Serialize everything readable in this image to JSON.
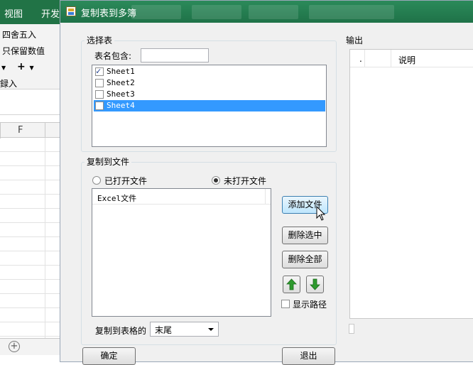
{
  "excel": {
    "tabs": [
      "视图",
      "开发"
    ],
    "ribbon": {
      "round_label": "四舍五入",
      "keep_values_label": "只保留数值",
      "add_label": "+",
      "entry_label": "録入"
    },
    "column_header": "F",
    "add_sheet": "+"
  },
  "dialog": {
    "title": "复制表到多簿",
    "select_sheet": {
      "legend": "选择表",
      "name_contains_label": "表名包含:",
      "name_contains_value": "",
      "sheets": [
        {
          "name": "Sheet1",
          "checked": true,
          "selected": false
        },
        {
          "name": "Sheet2",
          "checked": false,
          "selected": false
        },
        {
          "name": "Sheet3",
          "checked": false,
          "selected": false
        },
        {
          "name": "Sheet4",
          "checked": false,
          "selected": true
        }
      ]
    },
    "copy_to_file": {
      "legend": "复制到文件",
      "radio_opened": "已打开文件",
      "radio_unopened": "未打开文件",
      "selected_radio": "未打开文件",
      "file_list_header": "Excel文件",
      "add_file": "添加文件",
      "delete_selected": "删除选中",
      "delete_all": "删除全部",
      "show_path": "显示路径",
      "copy_position_label": "复制到表格的",
      "copy_position_value": "末尾"
    },
    "output": {
      "legend": "输出",
      "columns": [
        ".",
        "",
        "说明"
      ]
    },
    "footer": {
      "ok_label": "确定",
      "exit_label": "退出"
    }
  },
  "colors": {
    "excel_green": "#217346",
    "title_green": "#1f7248",
    "selection_blue": "#3399ff",
    "arrow_green": "#2e9a2e"
  }
}
